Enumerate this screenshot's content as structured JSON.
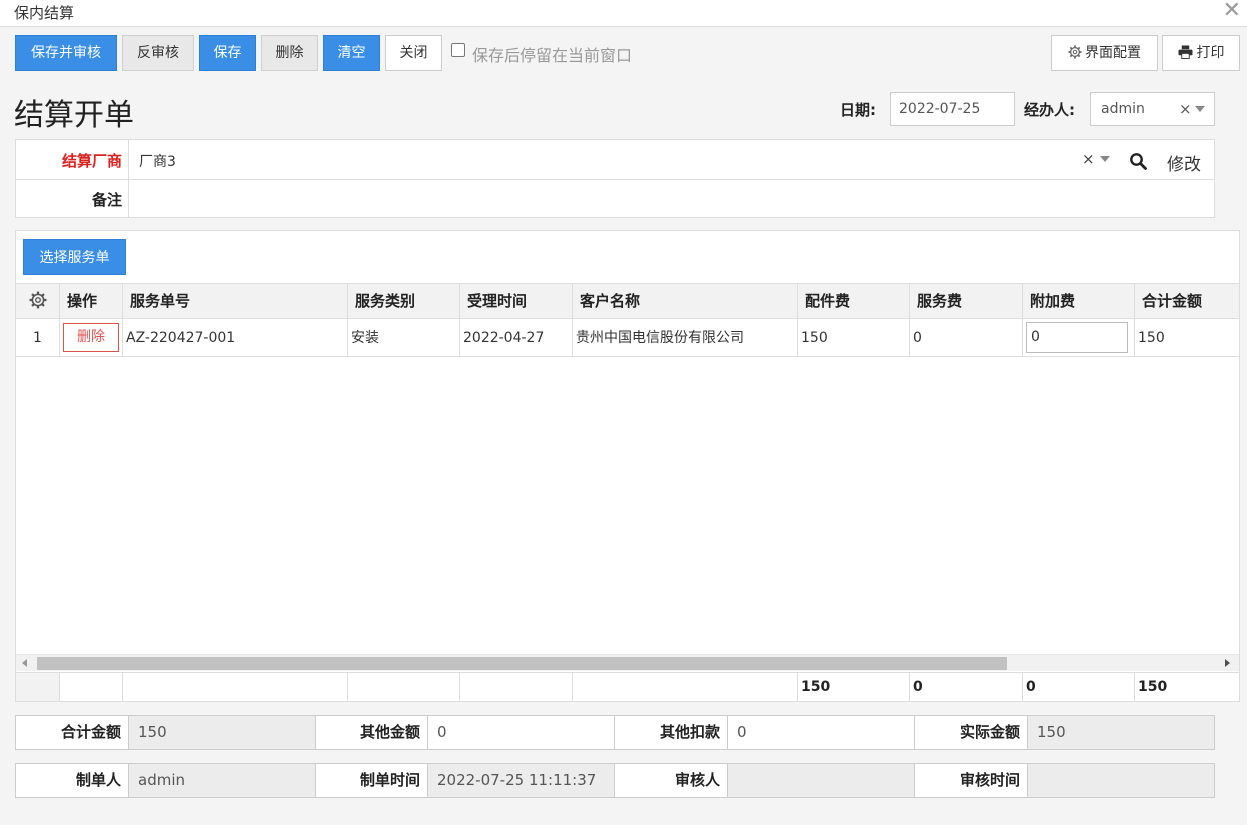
{
  "window": {
    "title": "保内结算"
  },
  "toolbar": {
    "save_approve": "保存并审核",
    "unapprove": "反审核",
    "save": "保存",
    "delete": "删除",
    "clear": "清空",
    "close": "关闭",
    "stay_label": "保存后停留在当前窗口",
    "ui_config": "界面配置",
    "print": "打印"
  },
  "header": {
    "title": "结算开单",
    "date_label": "日期:",
    "date_value": "2022-07-25",
    "handler_label": "经办人:",
    "handler_value": "admin"
  },
  "form": {
    "vendor_label": "结算厂商",
    "vendor_value": "厂商3",
    "modify_label": "修改",
    "remark_label": "备注",
    "remark_value": ""
  },
  "grid": {
    "select_button": "选择服务单",
    "columns": [
      "操作",
      "服务单号",
      "服务类别",
      "受理时间",
      "客户名称",
      "配件费",
      "服务费",
      "附加费",
      "合计金额"
    ],
    "rows": [
      {
        "index": "1",
        "action": "删除",
        "order_no": "AZ-220427-001",
        "service_type": "安装",
        "accept_time": "2022-04-27",
        "customer": "贵州中国电信股份有限公司",
        "parts_fee": "150",
        "service_fee": "0",
        "extra_fee": "0",
        "total": "150"
      }
    ],
    "scroll_fraction": 0.82,
    "footer": {
      "parts_fee": "150",
      "service_fee": "0",
      "extra_fee": "0",
      "total": "150"
    }
  },
  "summary": {
    "total_label": "合计金额",
    "total_value": "150",
    "other_label": "其他金额",
    "other_value": "0",
    "deduct_label": "其他扣款",
    "deduct_value": "0",
    "actual_label": "实际金额",
    "actual_value": "150"
  },
  "meta": {
    "creator_label": "制单人",
    "creator_value": "admin",
    "created_label": "制单时间",
    "created_value": "2022-07-25 11:11:37",
    "auditor_label": "审核人",
    "auditor_value": "",
    "audit_time_label": "审核时间",
    "audit_time_value": ""
  },
  "colors": {
    "primary": "#3a8ee6",
    "danger": "#d9534f",
    "required": "#d9221f"
  },
  "icons": {
    "close": "close-icon",
    "gear": "gear-icon",
    "printer": "printer-icon",
    "search": "search-icon"
  }
}
